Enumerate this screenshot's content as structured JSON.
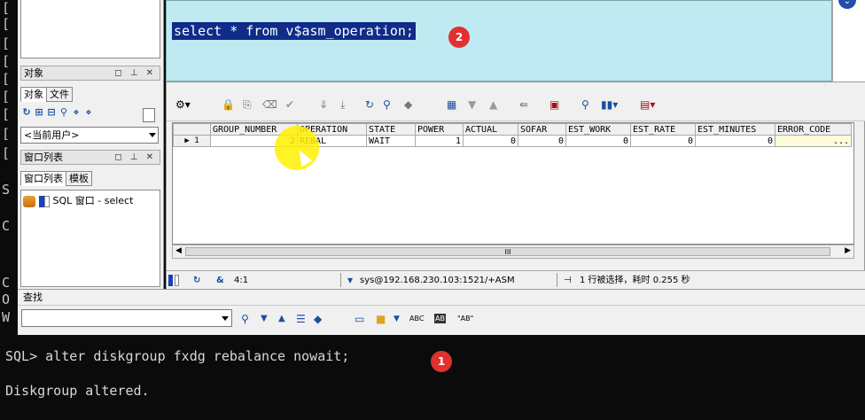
{
  "editor": {
    "sql": "select * from v$asm_operation;"
  },
  "left_panel": {
    "objects_title": "对象",
    "tabs": [
      "对象",
      "文件"
    ],
    "user_combo": "<当前用户>",
    "window_list_title": "窗口列表",
    "window_tabs": [
      "窗口列表",
      "模板"
    ],
    "window_item": "SQL 窗口 - select"
  },
  "grid": {
    "columns": [
      "GROUP_NUMBER",
      "OPERATION",
      "STATE",
      "POWER",
      "ACTUAL",
      "SOFAR",
      "EST_WORK",
      "EST_RATE",
      "EST_MINUTES",
      "ERROR_CODE"
    ],
    "rows": [
      {
        "index": "1",
        "GROUP_NUMBER": "2",
        "OPERATION": "REBAL",
        "STATE": "WAIT",
        "POWER": "1",
        "ACTUAL": "0",
        "SOFAR": "0",
        "EST_WORK": "0",
        "EST_RATE": "0",
        "EST_MINUTES": "0",
        "ERROR_CODE": "..."
      }
    ],
    "scroll_label": "III"
  },
  "status": {
    "position": "4:1",
    "connection": "sys@192.168.230.103:1521/+ASM",
    "message": "1 行被选择，耗时 0.255 秒"
  },
  "find": {
    "title": "查找",
    "abc": "ABC",
    "ab_box": "AB",
    "ab_quote": "\"AB\""
  },
  "terminal": {
    "left_frags": [
      "[",
      "[",
      "[",
      "[",
      "[",
      "[",
      "[",
      "[",
      "[",
      "S",
      "C",
      "C",
      "O",
      "W"
    ],
    "command": "SQL> alter diskgroup fxdg rebalance nowait;",
    "result": "Diskgroup altered."
  },
  "badges": {
    "one": "1",
    "two": "2"
  },
  "colors": {
    "editor_bg": "#bfeaf1",
    "selection": "#0f2c88",
    "badge": "#e03030",
    "cursor_highlight": "#fff000"
  }
}
